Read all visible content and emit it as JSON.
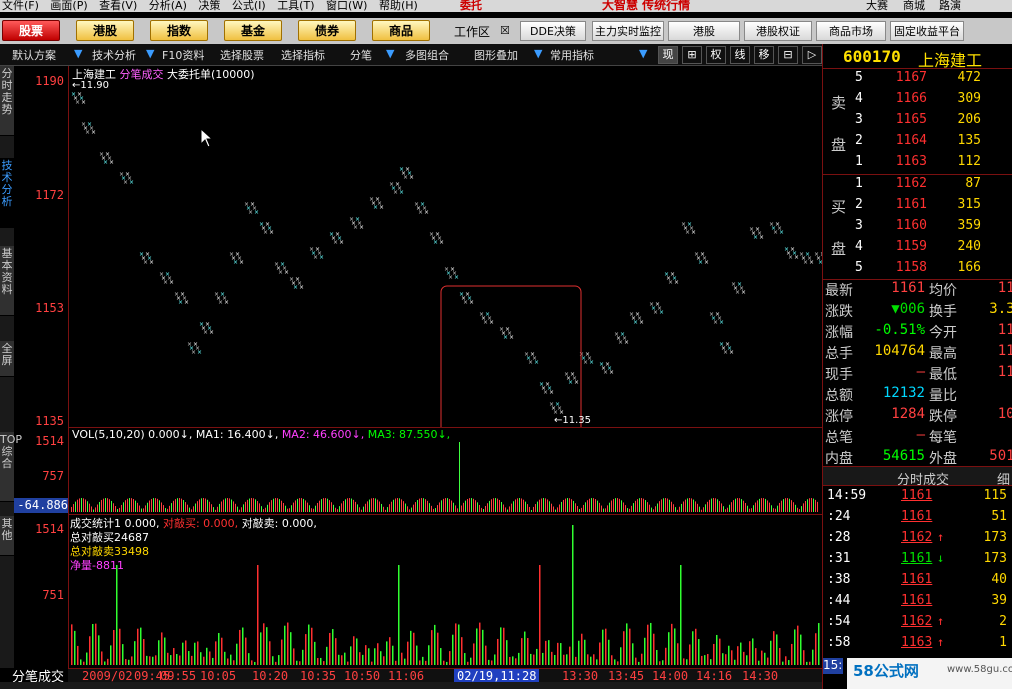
{
  "menu": {
    "items": [
      "文件(F)",
      "画面(P)",
      "查看(V)",
      "分析(A)",
      "决策",
      "公式(I)",
      "工具(T)",
      "窗口(W)",
      "帮助(H)"
    ],
    "trade": "委托",
    "brand": "大智慧 传统行情",
    "right": [
      "大赛",
      "商城",
      "路演"
    ],
    "window_close": "✕"
  },
  "toolbar": {
    "buttons": [
      "股票",
      "港股",
      "指数",
      "基金",
      "债券",
      "商品"
    ],
    "workspace": "工作区",
    "buttons2": [
      "DDE决策",
      "主力实时监控",
      "港股",
      "港股权证",
      "商品市场",
      "固定收益平台"
    ]
  },
  "subbar": {
    "items": [
      "默认方案",
      "技术分析",
      "F10资料",
      "选择股票",
      "选择指标",
      "分笔",
      "多图组合",
      "图形叠加",
      "常用指标"
    ],
    "tools": [
      "现",
      "⊞",
      "权",
      "线",
      "移",
      "⊟",
      "▷"
    ]
  },
  "sidetabs": [
    "分时走势",
    "技术分析",
    "基本资料",
    "全屏",
    "TOP综合",
    "其他"
  ],
  "chart": {
    "title_name": "上海建工",
    "title_type": "分笔成交",
    "title_extra": "大委托单(10000)",
    "y_labels": [
      "1190",
      "1172",
      "1153",
      "1135"
    ],
    "high_mark": "←11.90",
    "low_mark": "←11.35",
    "vol_title": "VOL(5,10,20) 0.000↓,",
    "vol_ma1": "MA1: 16.400↓,",
    "vol_ma2": "MA2: 46.600↓,",
    "vol_ma3": "MA3: 87.550↓,",
    "vol_y": [
      "1514",
      "757"
    ],
    "vol_neg": "-64.886",
    "stat_title": "成交统计1 0.000,",
    "stat_buy": "对敲买: 0.000,",
    "stat_sell": "对敲卖: 0.000,",
    "stat_l1": "总对敲买24687",
    "stat_l2": "总对敲卖33498",
    "stat_l3": "净量-8811",
    "stat_y": [
      "1514",
      "751"
    ],
    "time_labels": [
      "2009/02",
      "09:45",
      "09:55",
      "10:05",
      "10:20",
      "10:35",
      "10:50",
      "11:06",
      "02/19,11:28",
      "13:30",
      "13:45",
      "14:00",
      "14:16",
      "14:30"
    ],
    "tab_label": "分笔成交"
  },
  "quote": {
    "code": "600170",
    "name": "上海建工",
    "sell_label": [
      "卖",
      "盘"
    ],
    "buy_label": [
      "买",
      "盘"
    ],
    "asks": [
      {
        "lvl": "5",
        "px": "1167",
        "vol": "472"
      },
      {
        "lvl": "4",
        "px": "1166",
        "vol": "309"
      },
      {
        "lvl": "3",
        "px": "1165",
        "vol": "206"
      },
      {
        "lvl": "2",
        "px": "1164",
        "vol": "135"
      },
      {
        "lvl": "1",
        "px": "1163",
        "vol": "112"
      }
    ],
    "bids": [
      {
        "lvl": "1",
        "px": "1162",
        "vol": "87"
      },
      {
        "lvl": "2",
        "px": "1161",
        "vol": "315"
      },
      {
        "lvl": "3",
        "px": "1160",
        "vol": "359"
      },
      {
        "lvl": "4",
        "px": "1159",
        "vol": "240"
      },
      {
        "lvl": "5",
        "px": "1158",
        "vol": "166"
      }
    ],
    "rows": [
      {
        "k1": "最新",
        "v1": "1161",
        "k2": "均价",
        "v2": "115"
      },
      {
        "k1": "涨跌",
        "v1": "▼006",
        "k2": "换手",
        "v2": "3.34"
      },
      {
        "k1": "涨幅",
        "v1": "-0.51%",
        "k2": "今开",
        "v2": "118"
      },
      {
        "k1": "总手",
        "v1": "104764",
        "k2": "最高",
        "v2": "119"
      },
      {
        "k1": "现手",
        "v1": "–",
        "k2": "最低",
        "v2": "113"
      },
      {
        "k1": "总额",
        "v1": "12132",
        "k2": "量比",
        "v2": "0"
      },
      {
        "k1": "涨停",
        "v1": "1284",
        "k2": "跌停",
        "v2": "105"
      },
      {
        "k1": "总笔",
        "v1": "–",
        "k2": "每笔",
        "v2": ""
      },
      {
        "k1": "内盘",
        "v1": "54615",
        "k2": "外盘",
        "v2": "5014"
      }
    ],
    "ticks_title": "分时成交",
    "ticks_extra": "细",
    "ticks": [
      {
        "t": "14:59",
        "p": "1161",
        "ar": "",
        "v": "115"
      },
      {
        "t": ":24",
        "p": "1161",
        "ar": "",
        "v": "51"
      },
      {
        "t": ":28",
        "p": "1162",
        "ar": "↑",
        "v": "173"
      },
      {
        "t": ":31",
        "p": "1161",
        "ar": "↓",
        "v": "173"
      },
      {
        "t": ":38",
        "p": "1161",
        "ar": "",
        "v": "40"
      },
      {
        "t": ":44",
        "p": "1161",
        "ar": "",
        "v": "39"
      },
      {
        "t": ":54",
        "p": "1162",
        "ar": "↑",
        "v": "2"
      },
      {
        "t": ":58",
        "p": "1163",
        "ar": "↑",
        "v": "1"
      }
    ],
    "footer_left": "15:",
    "watermark": "58公式网",
    "watermark_url": "www.58gu.com"
  }
}
